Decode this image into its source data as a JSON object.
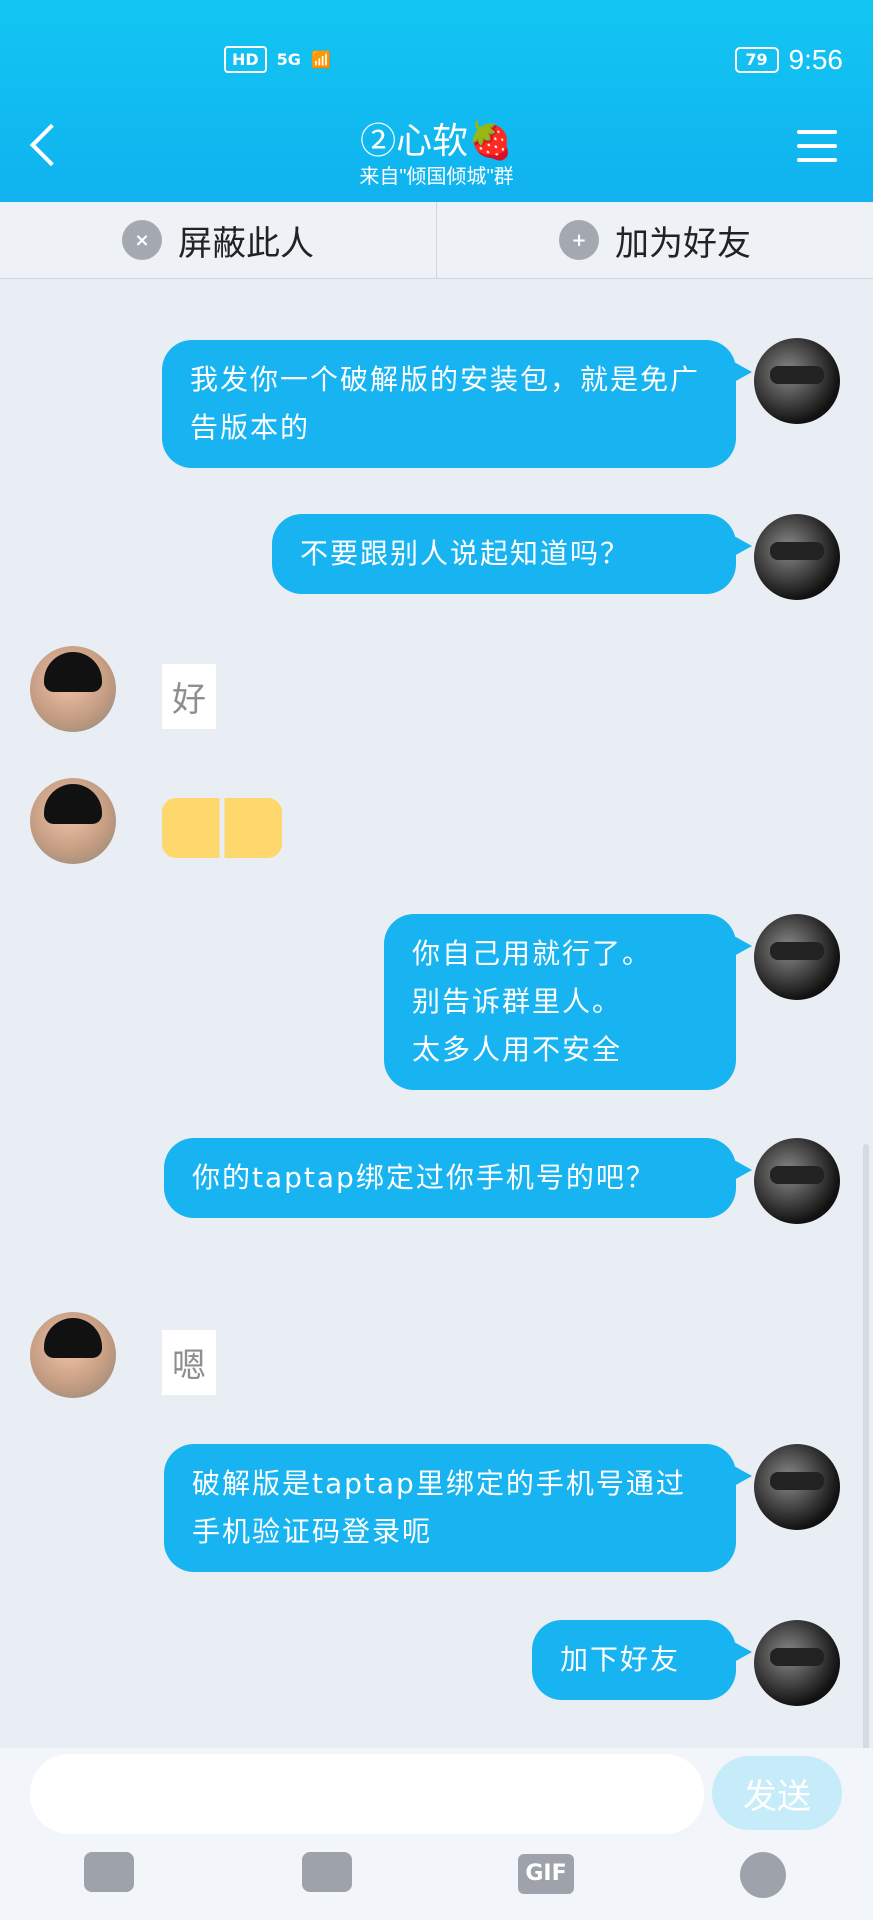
{
  "status": {
    "hd": "HD",
    "signal": "5G",
    "battery": "79",
    "time": "9:56"
  },
  "header": {
    "title": "②心软🍓",
    "subtitle": "来自\"倾国倾城\"群"
  },
  "actions": {
    "block": "屏蔽此人",
    "add_friend": "加为好友"
  },
  "messages": [
    {
      "side": "right",
      "text": "我发你一个破解版的安装包，就是免广告版本的"
    },
    {
      "side": "right",
      "text": "不要跟别人说起知道吗？"
    },
    {
      "side": "left",
      "text": "好"
    },
    {
      "side": "left",
      "emoji": "crying-face-emoji"
    },
    {
      "side": "right",
      "text": "你自己用就行了。\n别告诉群里人。\n太多人用不安全"
    },
    {
      "side": "right",
      "text": "你的taptap绑定过你手机号的吧？"
    },
    {
      "side": "left",
      "text": "嗯"
    },
    {
      "side": "right",
      "text": "破解版是taptap里绑定的手机号通过手机验证码登录呃"
    },
    {
      "side": "right",
      "text": "加下好友"
    }
  ],
  "composer": {
    "send_label": "发送",
    "gif_label": "GIF",
    "placeholder": ""
  }
}
